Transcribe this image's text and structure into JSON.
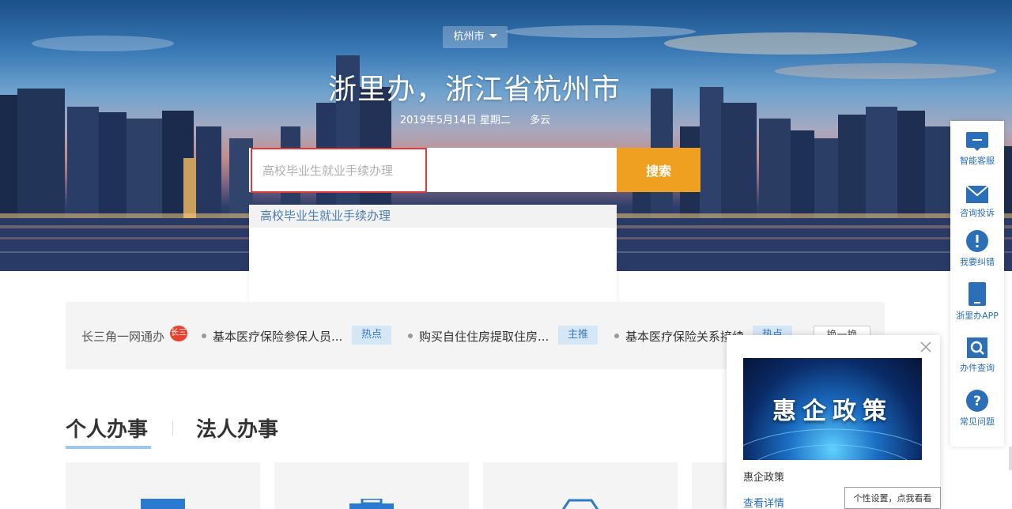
{
  "hero": {
    "city": "杭州市",
    "title": "浙里办，浙江省杭州市",
    "date": "2019年5月14日",
    "weekday": "星期二",
    "weather": "多云"
  },
  "search": {
    "placeholder": "高校毕业生就业手续办理",
    "button_label": "搜索",
    "suggestions": [
      "高校毕业生就业手续办理"
    ]
  },
  "hot": {
    "label": "长三角一网通办",
    "logo_text": "长三",
    "items": [
      {
        "text": "基本医疗保险参保人员...",
        "tag": "热点"
      },
      {
        "text": "购买自住住房提取住房...",
        "tag": "主推"
      },
      {
        "text": "基本医疗保险关系接续",
        "tag": "热点"
      }
    ],
    "refresh_label": "换一换"
  },
  "tabs": [
    {
      "label": "个人办事",
      "active": true
    },
    {
      "label": "法人办事",
      "active": false
    }
  ],
  "sidebar": {
    "items": [
      {
        "label": "智能客服",
        "icon": "chat-icon"
      },
      {
        "label": "咨询投诉",
        "icon": "mail-icon"
      },
      {
        "label": "我要纠错",
        "icon": "alert-icon"
      },
      {
        "label": "浙里办APP",
        "icon": "phone-icon"
      },
      {
        "label": "办件查询",
        "icon": "search-icon"
      },
      {
        "label": "常见问题",
        "icon": "question-icon"
      }
    ],
    "accent": "#2a6fb8"
  },
  "popup": {
    "image_text": "惠企政策",
    "title": "惠企政策",
    "link": "查看详情"
  },
  "tip": "个性设置，点我看看"
}
